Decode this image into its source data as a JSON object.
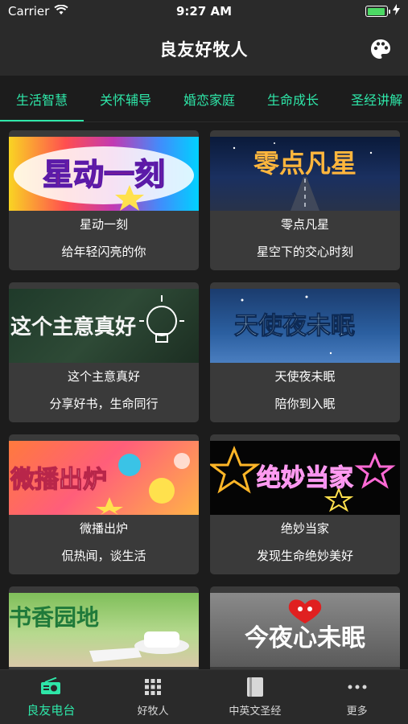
{
  "status": {
    "carrier": "Carrier",
    "time": "9:27 AM",
    "battery_level": 0.95
  },
  "nav": {
    "title": "良友好牧人"
  },
  "tabs": [
    {
      "label": "生活智慧",
      "active": true
    },
    {
      "label": "关怀辅导",
      "active": false
    },
    {
      "label": "婚恋家庭",
      "active": false
    },
    {
      "label": "生命成长",
      "active": false
    },
    {
      "label": "圣经讲解",
      "active": false
    }
  ],
  "cards": [
    {
      "image_text": "星动一刻",
      "title": "星动一刻",
      "subtitle": "给年轻闪亮的你"
    },
    {
      "image_text": "零点凡星",
      "title": "零点凡星",
      "subtitle": "星空下的交心时刻"
    },
    {
      "image_text": "这个主意真好",
      "title": "这个主意真好",
      "subtitle": "分享好书，生命同行"
    },
    {
      "image_text": "天使夜未眠",
      "title": "天使夜未眠",
      "subtitle": "陪你到入眠"
    },
    {
      "image_text": "微播出炉",
      "title": "微播出炉",
      "subtitle": "侃热闻，谈生活"
    },
    {
      "image_text": "绝妙当家",
      "title": "绝妙当家",
      "subtitle": "发现生命绝妙美好"
    },
    {
      "image_text": "书香园地",
      "title": "",
      "subtitle": ""
    },
    {
      "image_text": "今夜心未眠",
      "title": "",
      "subtitle": ""
    }
  ],
  "tabbar": [
    {
      "label": "良友电台",
      "icon": "radio-icon",
      "active": true
    },
    {
      "label": "好牧人",
      "icon": "grid-icon",
      "active": false
    },
    {
      "label": "中英文圣经",
      "icon": "book-icon",
      "active": false
    },
    {
      "label": "更多",
      "icon": "more-icon",
      "active": false
    }
  ],
  "colors": {
    "accent": "#2ee6a8",
    "background": "#1c1c1c",
    "card": "#3a3a3a",
    "bar": "#2a2a2a"
  }
}
